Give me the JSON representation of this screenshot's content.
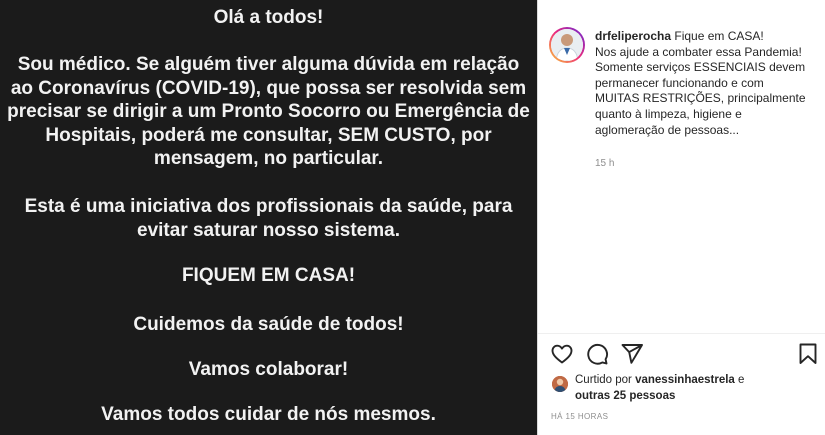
{
  "image_text": {
    "greeting": "Olá a todos!",
    "para1_lines": [
      "Sou médico. Se alguém tiver alguma dúvida em relação",
      "ao Coronavírus (COVID-19), que possa ser resolvida sem",
      "precisar se dirigir a um Pronto Socorro ou Emergência de",
      "Hospitais, poderá me consultar, SEM CUSTO, por",
      "mensagem, no particular."
    ],
    "para2_lines": [
      "Esta é uma iniciativa dos profissionais da saúde, para",
      "evitar saturar nosso sistema."
    ],
    "stay_home": "FIQUEM EM CASA!",
    "care": "Cuidemos da saúde de todos!",
    "collaborate": "Vamos colaborar!",
    "ourselves": "Vamos todos cuidar de nós mesmos."
  },
  "post": {
    "username": "drfeliperocha",
    "caption_lines": [
      "Fique em CASA!",
      "Nos ajude a combater essa Pandemia!",
      "Somente serviços ESSENCIAIS devem",
      "permanecer funcionando e com",
      "MUITAS RESTRIÇÕES, principalmente",
      "quanto à limpeza, higiene e",
      "aglomeração de pessoas..."
    ],
    "time": "15 h"
  },
  "actions": {
    "like_icon": "heart-outline-icon",
    "comment_icon": "comment-icon",
    "share_icon": "paper-plane-icon",
    "save_icon": "bookmark-icon"
  },
  "likes": {
    "prefix": "Curtido por",
    "user": "vanessinhaestrela",
    "conj": "e",
    "others": "outras 25 pessoas"
  },
  "ago": "HÁ 15 HORAS",
  "colors": {
    "image_bg": "#1b1b1b",
    "text": "#262626",
    "muted": "#8e8e8e"
  }
}
